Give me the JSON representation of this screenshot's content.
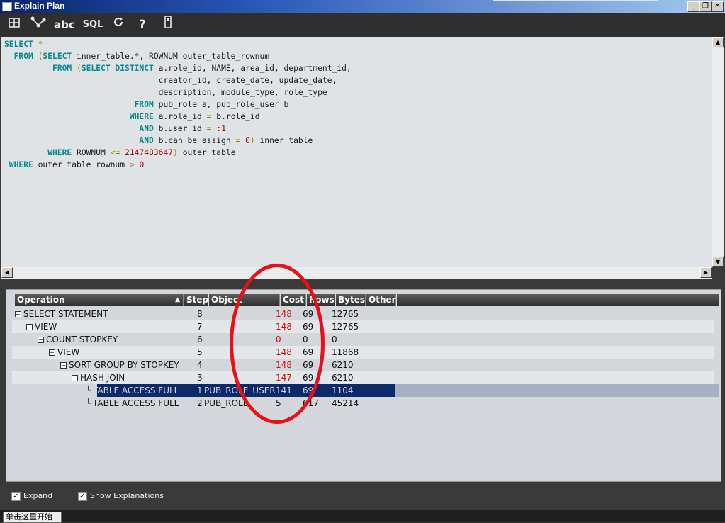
{
  "window": {
    "title": "Explain Plan",
    "buttons": [
      "_",
      "❐",
      "✕"
    ]
  },
  "toolbar": {
    "abc": "abc",
    "sql": "SQL",
    "help": "?",
    "icons": [
      "grid-icon",
      "tree-network-icon",
      "abc-icon",
      "sql-icon",
      "refresh-icon",
      "help-icon",
      "device-icon"
    ]
  },
  "sql": {
    "l1": [
      "SELECT",
      " *"
    ],
    "l2": [
      "  FROM",
      " (",
      "SELECT",
      " inner_table.*, ROWNUM outer_table_rownum"
    ],
    "l3": [
      "          FROM",
      " (",
      "SELECT DISTINCT",
      " a.role_id, NAME, area_id, department_id,"
    ],
    "l4": "                                creator_id, create_date, update_date,",
    "l5": "                                description, module_type, role_type",
    "l6": [
      "                           FROM",
      " pub_role a, pub_role_user b"
    ],
    "l7": [
      "                          WHERE",
      " a.role_id ",
      "=",
      " b.role_id"
    ],
    "l8": [
      "                            AND",
      " b.user_id ",
      "=",
      " :1"
    ],
    "l9": [
      "                            AND",
      " b.can_be_assign ",
      "=",
      " 0",
      ")",
      " inner_table"
    ],
    "l10": [
      "         WHERE",
      " ROWNUM ",
      "<=",
      " 2147483647",
      ")",
      " outer_table"
    ],
    "l11": [
      " WHERE",
      " outer_table_rownum ",
      ">",
      " 0"
    ]
  },
  "plan": {
    "columns": [
      "Operation",
      "Step",
      "Object",
      "Cost",
      "Rows",
      "Bytes",
      "Other"
    ],
    "rows": [
      {
        "op": "SELECT STATEMENT",
        "step": "8",
        "object": "",
        "cost": "148",
        "rows": "69",
        "bytes": "12765"
      },
      {
        "op": "VIEW",
        "step": "7",
        "object": "",
        "cost": "148",
        "rows": "69",
        "bytes": "12765"
      },
      {
        "op": "COUNT STOPKEY",
        "step": "6",
        "object": "",
        "cost": "0",
        "rows": "0",
        "bytes": "0"
      },
      {
        "op": "VIEW",
        "step": "5",
        "object": "",
        "cost": "148",
        "rows": "69",
        "bytes": "11868"
      },
      {
        "op": "SORT GROUP BY STOPKEY",
        "step": "4",
        "object": "",
        "cost": "148",
        "rows": "69",
        "bytes": "6210"
      },
      {
        "op": "HASH JOIN",
        "step": "3",
        "object": "",
        "cost": "147",
        "rows": "69",
        "bytes": "6210"
      },
      {
        "op": "TABLE ACCESS FULL",
        "step": "1",
        "object": "PUB_ROLE_USER",
        "cost": "141",
        "rows": "69",
        "bytes": "1104"
      },
      {
        "op": "TABLE ACCESS FULL",
        "step": "2",
        "object": "PUB_ROLE",
        "cost": "5",
        "rows": "617",
        "bytes": "45214"
      }
    ]
  },
  "options": {
    "expand": "Expand",
    "show_explanations": "Show Explanations"
  },
  "taskbar": {
    "start": "单击这里开始"
  },
  "colors": {
    "annotation": "#e8101a",
    "cost_highlight": "#d01010",
    "selection": "#0a2a6a"
  }
}
